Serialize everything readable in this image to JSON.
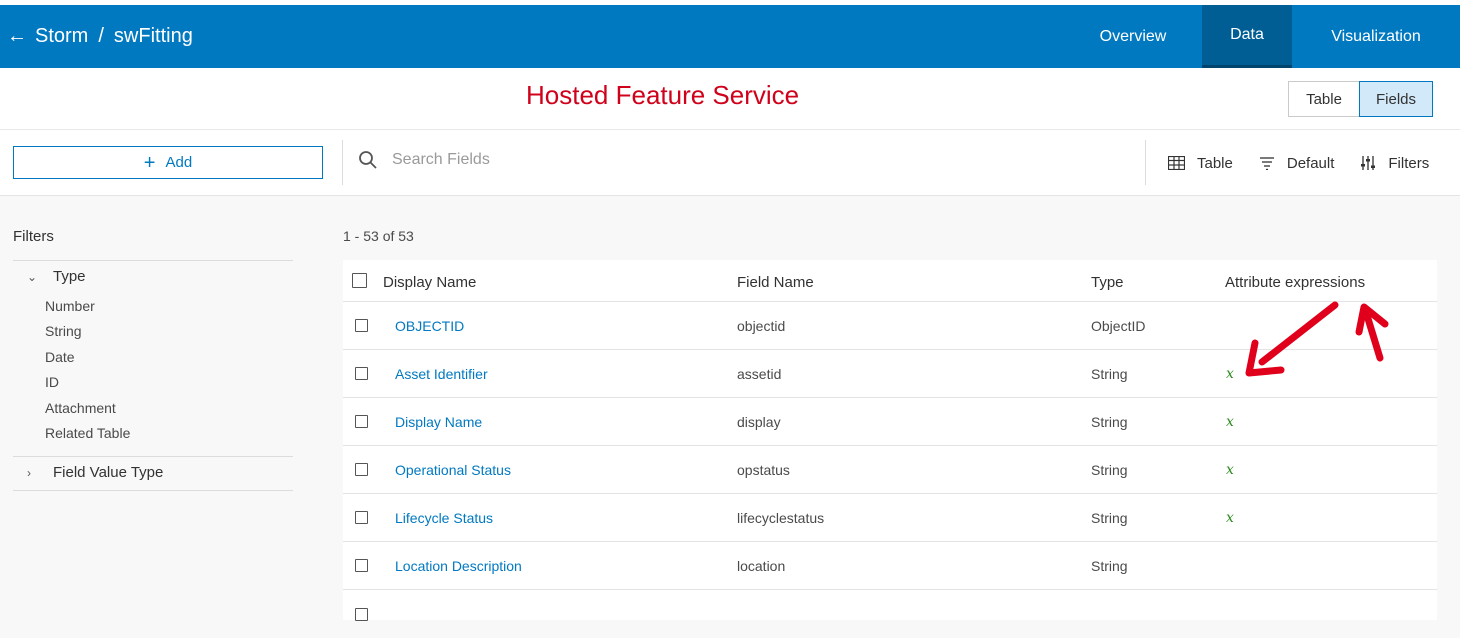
{
  "header": {
    "back_icon": "arrow-left-icon",
    "breadcrumb_parent": "Storm",
    "breadcrumb_separator": "/",
    "breadcrumb_current": "swFitting",
    "tabs": [
      {
        "label": "Overview",
        "active": false
      },
      {
        "label": "Data",
        "active": true
      },
      {
        "label": "Visualization",
        "active": false
      }
    ],
    "bg_color": "#0079c1"
  },
  "annotation": {
    "title": "Hosted Feature Service",
    "color": "#d0021b"
  },
  "view_toggle": {
    "table_label": "Table",
    "fields_label": "Fields",
    "selected": "Fields"
  },
  "toolbar": {
    "add_label": "Add",
    "search_placeholder": "Search Fields",
    "table_label": "Table",
    "default_label": "Default",
    "filters_label": "Filters"
  },
  "sidebar": {
    "title": "Filters",
    "type_group": "Type",
    "type_items": [
      "Number",
      "String",
      "Date",
      "ID",
      "Attachment",
      "Related Table"
    ],
    "field_value_group": "Field Value Type"
  },
  "results": {
    "count_text": "1 - 53 of 53"
  },
  "table": {
    "columns": [
      "Display Name",
      "Field Name",
      "Type",
      "Attribute expressions"
    ],
    "rows": [
      {
        "display": "OBJECTID",
        "field": "objectid",
        "type": "ObjectID",
        "expr": ""
      },
      {
        "display": "Asset Identifier",
        "field": "assetid",
        "type": "String",
        "expr": "x"
      },
      {
        "display": "Display Name",
        "field": "display",
        "type": "String",
        "expr": "x"
      },
      {
        "display": "Operational Status",
        "field": "opstatus",
        "type": "String",
        "expr": "x"
      },
      {
        "display": "Lifecycle Status",
        "field": "lifecyclestatus",
        "type": "String",
        "expr": "x"
      },
      {
        "display": "Location Description",
        "field": "location",
        "type": "String",
        "expr": ""
      }
    ]
  }
}
